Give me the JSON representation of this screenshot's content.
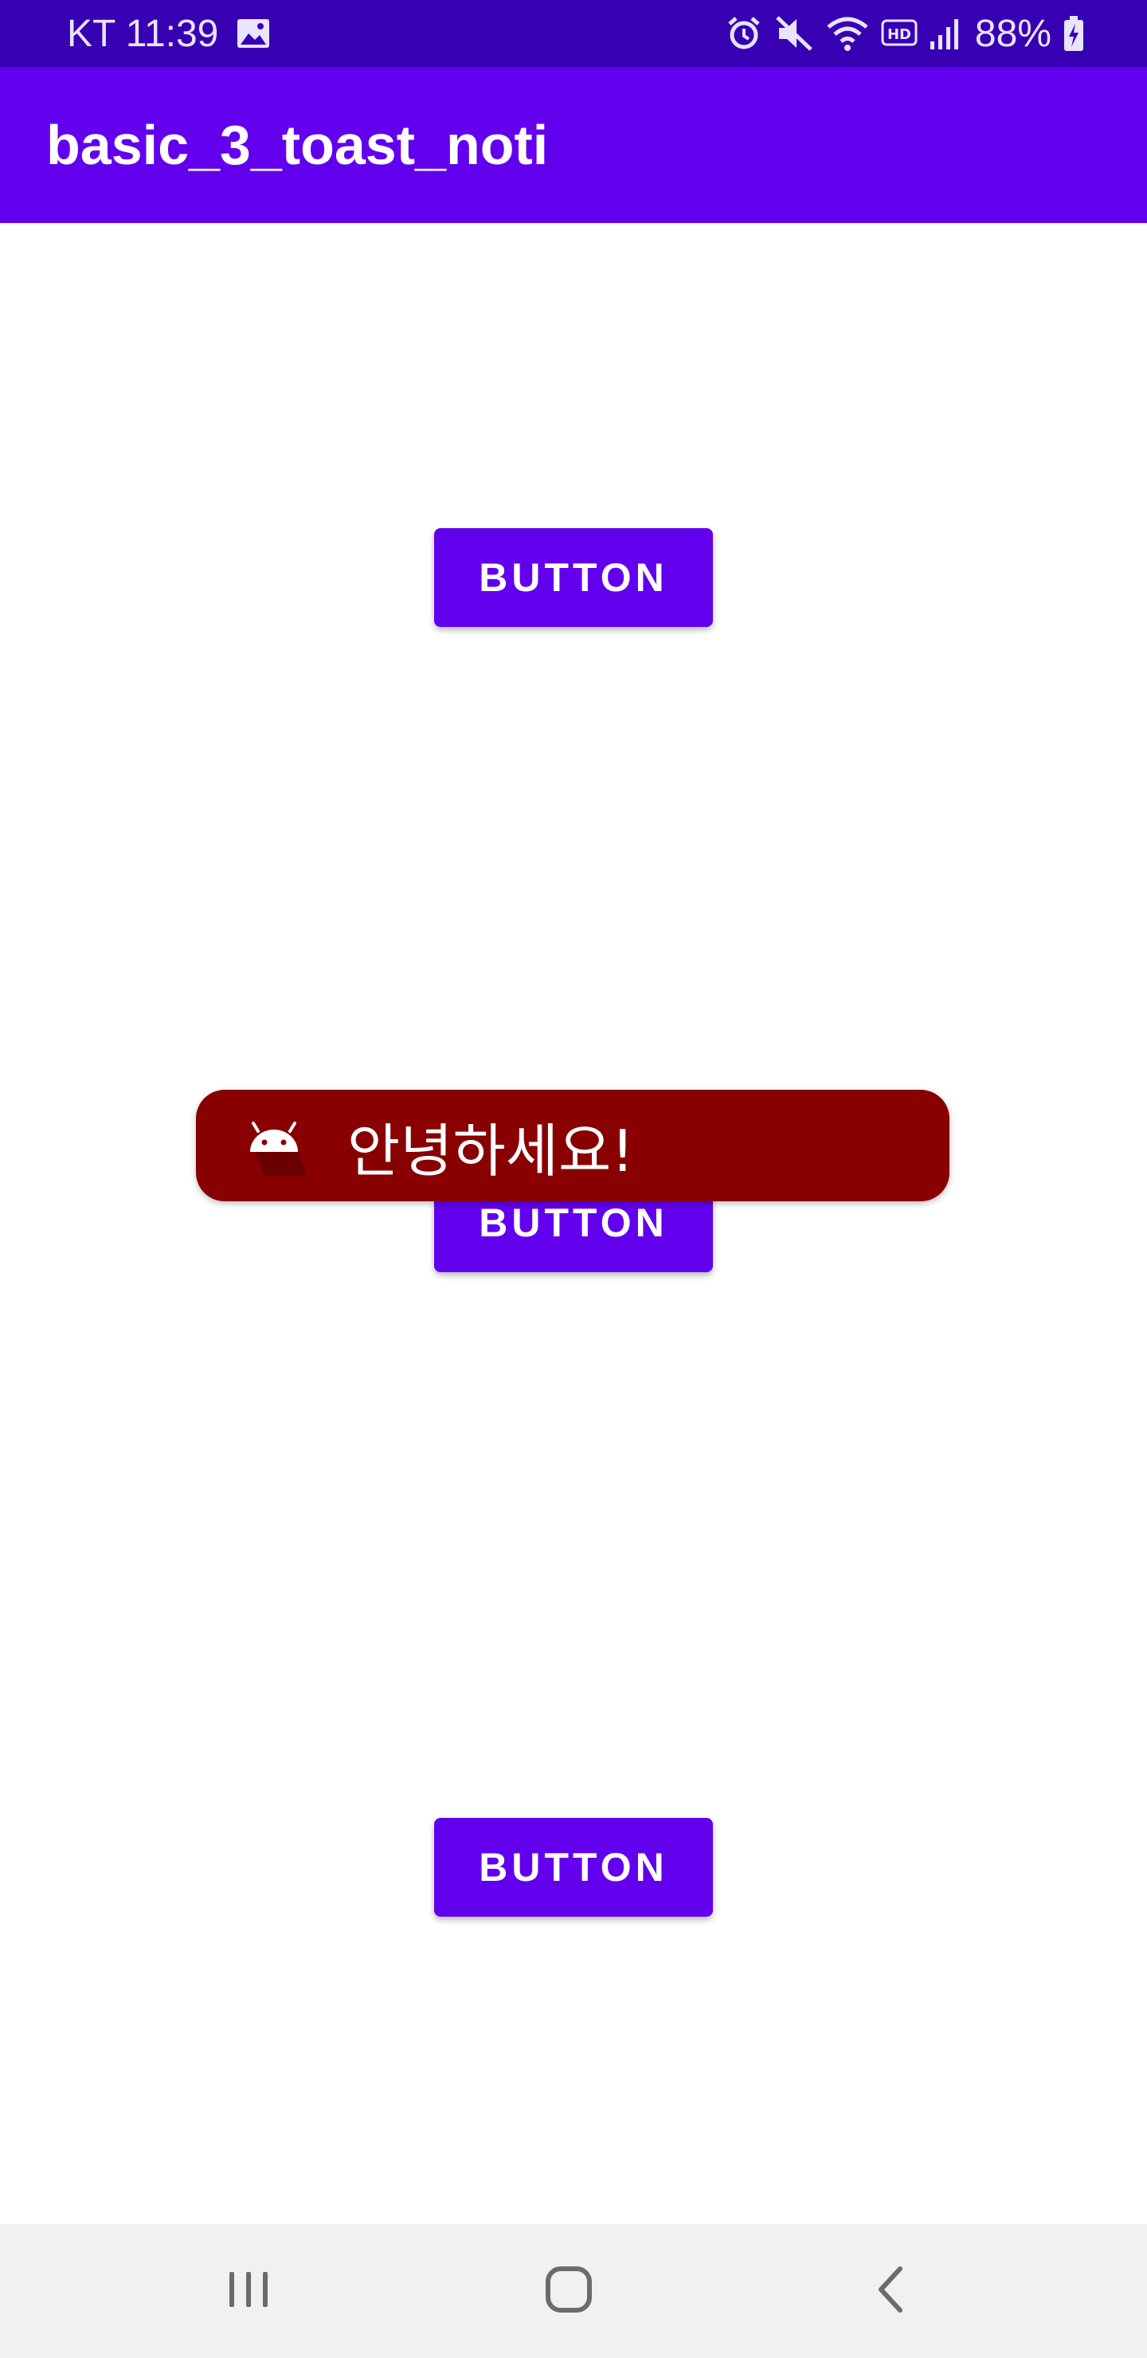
{
  "status_bar": {
    "carrier_time": "KT 11:39",
    "battery": "88%",
    "icons": [
      "gallery-icon",
      "alarm-icon",
      "mute-icon",
      "wifi-icon",
      "hd-icon",
      "signal-icon",
      "battery-charging-icon"
    ],
    "background_color": "#3700b3"
  },
  "app_bar": {
    "title": "basic_3_toast_noti",
    "background_color": "#6200ee"
  },
  "buttons": [
    {
      "label": "BUTTON"
    },
    {
      "label": "BUTTON"
    },
    {
      "label": "BUTTON"
    }
  ],
  "toast": {
    "icon": "android-icon",
    "message": "안녕하세요!",
    "background_color": "#880000"
  },
  "nav_bar": {
    "items": [
      "recents-icon",
      "home-icon",
      "back-icon"
    ]
  },
  "colors": {
    "accent": "#6200ee",
    "accent_dark": "#3700b3",
    "toast": "#880000"
  }
}
